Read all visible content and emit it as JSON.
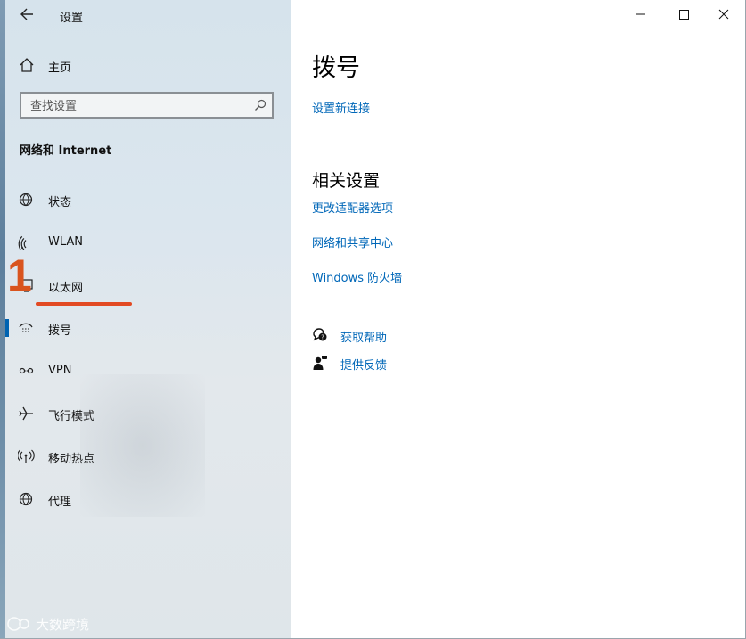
{
  "window": {
    "title": "设置"
  },
  "sidebar": {
    "home_label": "主页",
    "search_placeholder": "查找设置",
    "section_title": "网络和 Internet",
    "items": [
      {
        "label": "状态",
        "icon": "globe-status-icon"
      },
      {
        "label": "WLAN",
        "icon": "wifi-icon"
      },
      {
        "label": "以太网",
        "icon": "ethernet-icon"
      },
      {
        "label": "拨号",
        "icon": "dialup-icon",
        "selected": true
      },
      {
        "label": "VPN",
        "icon": "vpn-icon"
      },
      {
        "label": "飞行模式",
        "icon": "airplane-icon"
      },
      {
        "label": "移动热点",
        "icon": "hotspot-icon"
      },
      {
        "label": "代理",
        "icon": "globe-proxy-icon"
      }
    ]
  },
  "main": {
    "title": "拨号",
    "setup_link": "设置新连接",
    "related_title": "相关设置",
    "related_links": [
      "更改适配器选项",
      "网络和共享中心",
      "Windows 防火墙"
    ],
    "help_links": [
      {
        "label": "获取帮助",
        "icon": "help-chat-icon"
      },
      {
        "label": "提供反馈",
        "icon": "feedback-icon"
      }
    ]
  },
  "annotation": {
    "step_number": "1",
    "color": "#e24a23"
  },
  "watermark": {
    "text": "大数跨境"
  },
  "colors": {
    "accent": "#0063b1",
    "link": "#0067b8"
  }
}
